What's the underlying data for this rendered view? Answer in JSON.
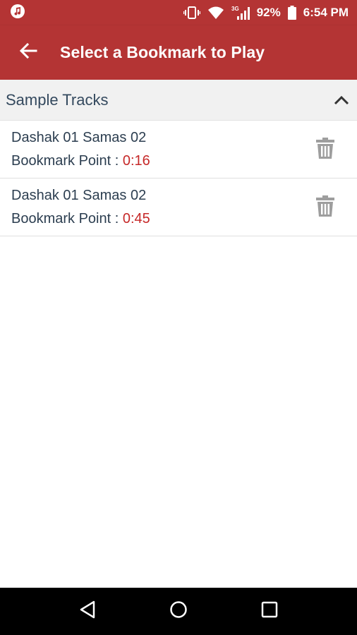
{
  "status_bar": {
    "battery": "92%",
    "time": "6:54 PM",
    "network": "3G",
    "icons": [
      "music-app-icon",
      "vibrate-icon",
      "wifi-icon",
      "signal-icon",
      "battery-icon"
    ]
  },
  "app_bar": {
    "title": "Select a Bookmark to Play",
    "back_icon": "arrow-back-icon"
  },
  "section": {
    "title": "Sample Tracks",
    "expanded": true,
    "chevron_icon": "chevron-up-icon"
  },
  "bookmarks": [
    {
      "track": "Dashak 01 Samas 02",
      "label": "Bookmark Point : ",
      "time": "0:16",
      "delete_icon": "trash-icon"
    },
    {
      "track": "Dashak 01 Samas 02",
      "label": "Bookmark Point : ",
      "time": "0:45",
      "delete_icon": "trash-icon"
    }
  ],
  "nav_bar": {
    "icons": [
      "back-triangle-icon",
      "home-circle-icon",
      "recents-square-icon"
    ]
  },
  "colors": {
    "primary": "#b43434",
    "section_bg": "#f1f1f1",
    "text": "#2c3e50",
    "time": "#c62828",
    "icon_gray": "#9e9e9e"
  }
}
